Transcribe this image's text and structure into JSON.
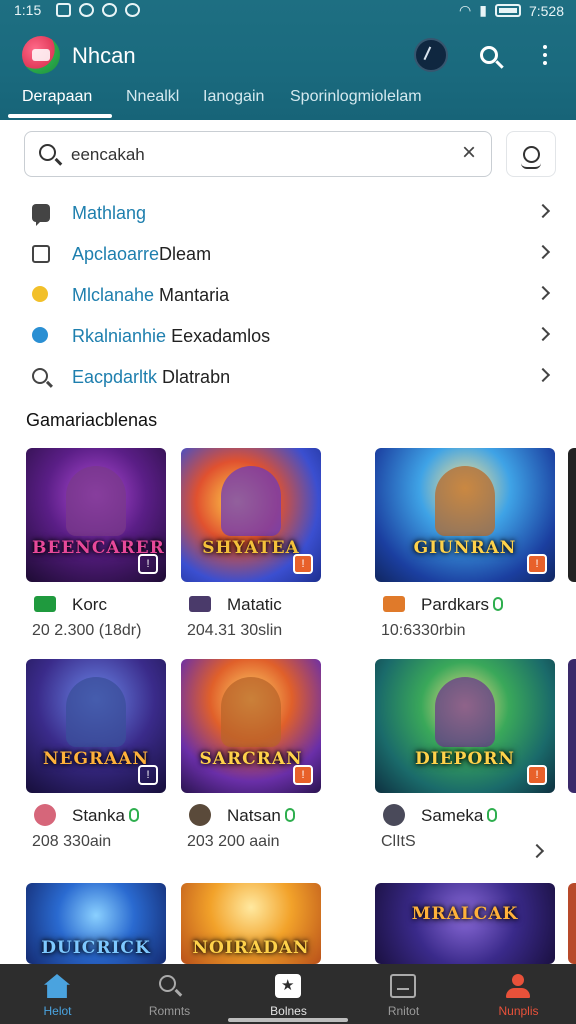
{
  "status_bar": {
    "time": "1:15",
    "right_text": "7:528"
  },
  "header": {
    "app_title": "Nhcan",
    "tabs": [
      {
        "label": "Derapaan",
        "active": true
      },
      {
        "label": "Nnealkl",
        "active": false
      },
      {
        "label": "Ianogain",
        "active": false
      },
      {
        "label": "Sporinlogmiolelam",
        "active": false
      }
    ]
  },
  "search": {
    "value": "eencakah",
    "clear_icon": "close-icon",
    "voice_icon": "voice-search-icon"
  },
  "menu": {
    "items": [
      {
        "highlight": "Mathlang",
        "rest": "",
        "icon": "chat-icon"
      },
      {
        "highlight": "Apclaoarre",
        "rest": "Dleam",
        "icon": "square-icon"
      },
      {
        "highlight": "Mlclanahe",
        "rest": " Mantaria",
        "icon": "yellow-dot-icon"
      },
      {
        "highlight": "Rkalnianhie",
        "rest": " Eexadamlos",
        "icon": "blue-dot-icon"
      },
      {
        "highlight": "Eacpdarltk",
        "rest": " Dlatrabn",
        "icon": "search-icon"
      }
    ]
  },
  "section": {
    "title": "Gamariacblenas"
  },
  "games": [
    {
      "banner": "BEENCARER",
      "name": "Korc",
      "sub": "20 2.300 (18dr)",
      "banner_color": "#e8499a"
    },
    {
      "banner": "SHYATEA",
      "name": "Matatic",
      "sub": "204.31 30slin",
      "banner_color": "#f4c13a"
    },
    {
      "banner": "GIUNRAN",
      "name": "Pardkars",
      "sub": "10:6330rbin",
      "banner_color": "#ffd24a"
    },
    {
      "banner": "NEGRAAN",
      "name": "Stanka",
      "sub": "208 330ain",
      "banner_color": "#ffb13a"
    },
    {
      "banner": "SARCRAN",
      "name": "Natsan",
      "sub": "203 200 aain",
      "banner_color": "#ffd24a"
    },
    {
      "banner": "DIEPORN",
      "name": "Sameka",
      "sub": "ClItS",
      "banner_color": "#ffd24a"
    },
    {
      "banner": "DUICRICK",
      "name": "",
      "sub": "",
      "banner_color": "#7ec9ff"
    },
    {
      "banner": "NOIRADAN",
      "name": "",
      "sub": "",
      "banner_color": "#ffd24a"
    },
    {
      "banner": "MRALCAK",
      "name": "",
      "sub": "",
      "banner_color": "#ffb13a"
    }
  ],
  "bottom_nav": [
    {
      "label": "Helot",
      "icon": "home-icon",
      "active": true
    },
    {
      "label": "Romnts",
      "icon": "search-icon",
      "active": false
    },
    {
      "label": "Bolnes",
      "icon": "games-icon",
      "active": false
    },
    {
      "label": "Rnitot",
      "icon": "library-icon",
      "active": false
    },
    {
      "label": "Nunplis",
      "icon": "profile-icon",
      "active": false
    }
  ]
}
